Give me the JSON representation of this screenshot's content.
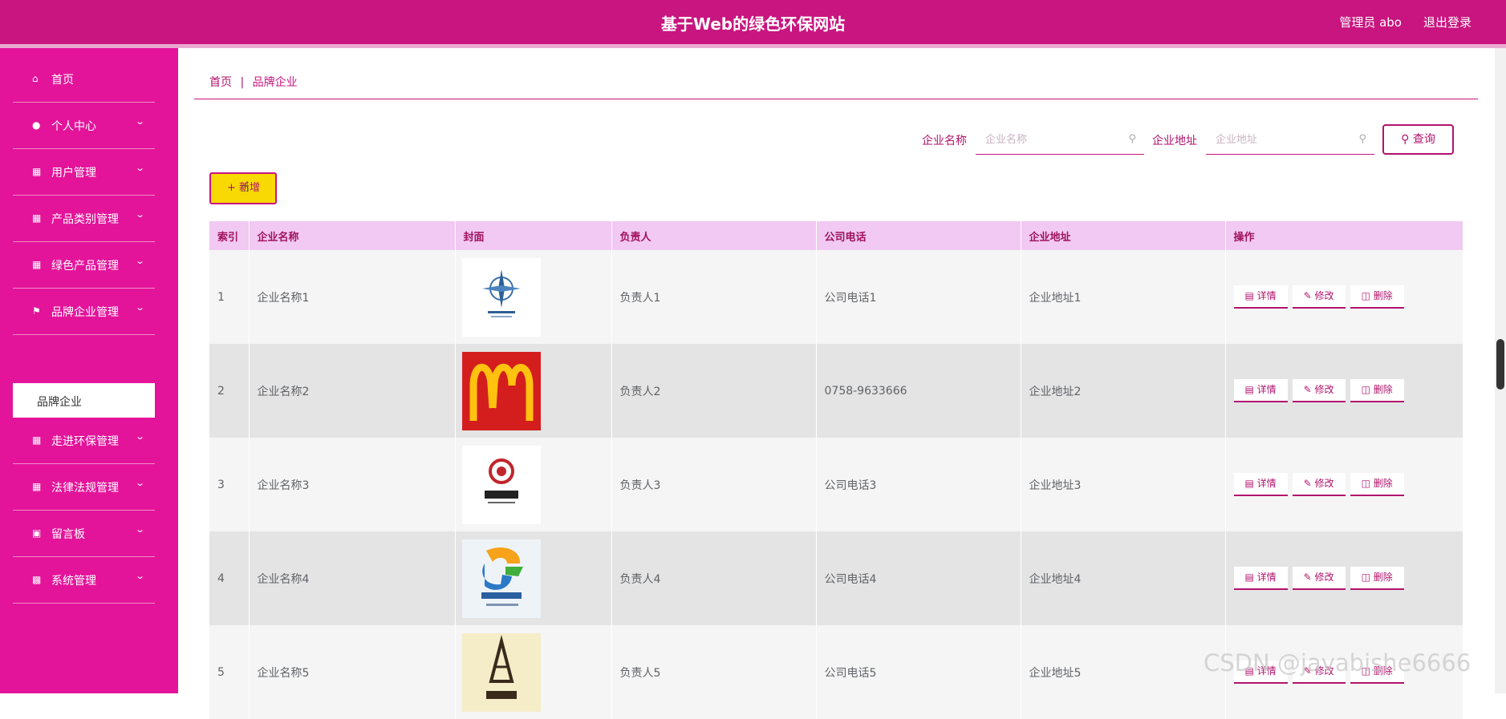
{
  "header": {
    "site_title": "基于Web的绿色环保网站",
    "user_label": "管理员 abo",
    "logout_label": "退出登录"
  },
  "sidebar": {
    "items": [
      {
        "label": "首页",
        "icon": "home-icon"
      },
      {
        "label": "个人中心",
        "icon": "person-icon"
      },
      {
        "label": "用户管理",
        "icon": "clipboard-icon"
      },
      {
        "label": "产品类别管理",
        "icon": "grid-icon"
      },
      {
        "label": "绿色产品管理",
        "icon": "grid-icon"
      },
      {
        "label": "品牌企业管理",
        "icon": "flag-icon"
      },
      {
        "label": "走进环保管理",
        "icon": "clipboard-icon"
      },
      {
        "label": "法律法规管理",
        "icon": "grid-icon"
      },
      {
        "label": "留言板",
        "icon": "briefcase-icon"
      },
      {
        "label": "系统管理",
        "icon": "monitor-icon"
      }
    ],
    "active_sub": "品牌企业"
  },
  "breadcrumb": {
    "home": "首页",
    "separator": "|",
    "current": "品牌企业"
  },
  "search": {
    "name_label": "企业名称",
    "name_placeholder": "企业名称",
    "address_label": "企业地址",
    "address_placeholder": "企业地址",
    "query_label": "查询"
  },
  "toolbar": {
    "add_label": "新增"
  },
  "table": {
    "headers": [
      "索引",
      "企业名称",
      "封面",
      "负责人",
      "公司电话",
      "企业地址",
      "操作"
    ],
    "rows": [
      {
        "index": "1",
        "name": "企业名称1",
        "cover": "logo-compass",
        "person": "负责人1",
        "phone": "公司电话1",
        "address": "企业地址1"
      },
      {
        "index": "2",
        "name": "企业名称2",
        "cover": "logo-mcdonalds",
        "person": "负责人2",
        "phone": "0758-9633666",
        "address": "企业地址2"
      },
      {
        "index": "3",
        "name": "企业名称3",
        "cover": "logo-invest",
        "person": "负责人3",
        "phone": "公司电话3",
        "address": "企业地址3"
      },
      {
        "index": "4",
        "name": "企业名称4",
        "cover": "logo-tencent-games",
        "person": "负责人4",
        "phone": "公司电话4",
        "address": "企业地址4"
      },
      {
        "index": "5",
        "name": "企业名称5",
        "cover": "logo-tower",
        "person": "负责人5",
        "phone": "公司电话5",
        "address": "企业地址5"
      }
    ],
    "actions": {
      "detail": "详情",
      "edit": "修改",
      "delete": "删除"
    }
  },
  "watermark": "CSDN @javabishe6666",
  "colors": {
    "primary": "#c8157f",
    "sidebar": "#e3149a",
    "add_button": "#f9d904",
    "table_header": "#f1c9f2"
  }
}
